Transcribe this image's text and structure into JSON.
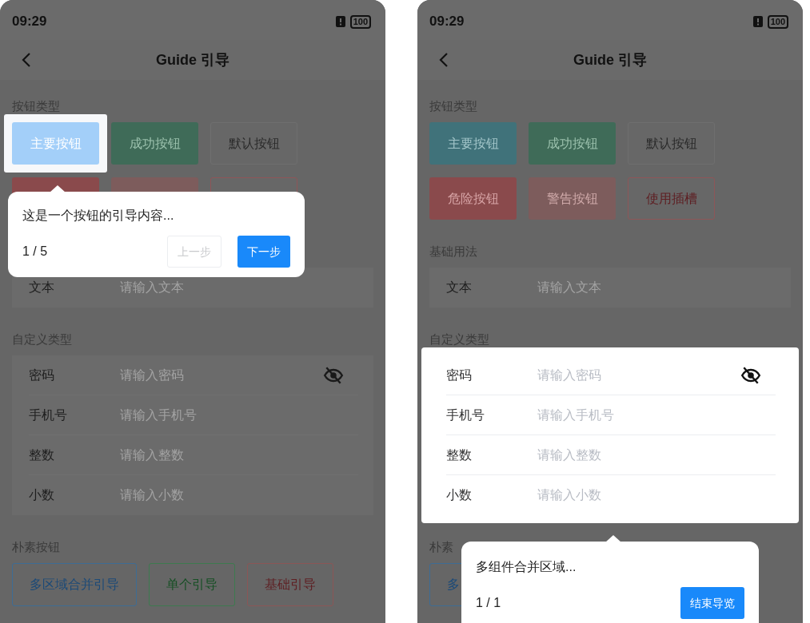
{
  "phones": [
    {
      "status_bar": {
        "time": "09:29",
        "battery": "100"
      },
      "nav": {
        "title": "Guide 引导"
      },
      "sections": [
        {
          "kind": "buttons",
          "title": "按钮类型",
          "rows": [
            [
              {
                "kind": "primary",
                "label": "主要按钮",
                "highlighted": true
              },
              {
                "kind": "success",
                "label": "成功按钮",
                "highlighted": false
              },
              {
                "kind": "default",
                "label": "默认按钮",
                "highlighted": false
              }
            ],
            [
              {
                "kind": "danger",
                "highlighted": false
              },
              {
                "kind": "warning",
                "highlighted": false
              },
              {
                "kind": "plain-danger",
                "highlighted": false
              }
            ]
          ]
        },
        {
          "kind": "fields",
          "highlighted": false,
          "fields": [
            {
              "kind": "text",
              "label": "文本",
              "placeholder": "请输入文本"
            }
          ]
        },
        {
          "kind": "fields",
          "title": "自定义类型",
          "highlighted": false,
          "fields": [
            {
              "kind": "password",
              "label": "密码",
              "placeholder": "请输入密码"
            },
            {
              "kind": "text",
              "label": "手机号",
              "placeholder": "请输入手机号"
            },
            {
              "kind": "text",
              "label": "整数",
              "placeholder": "请输入整数"
            },
            {
              "kind": "text",
              "label": "小数",
              "placeholder": "请输入小数"
            }
          ]
        },
        {
          "kind": "plain_buttons",
          "title": "朴素按钮",
          "buttons": [
            {
              "kind": "primary",
              "label": "多区域合并引导"
            },
            {
              "kind": "success",
              "label": "单个引导"
            },
            {
              "kind": "danger",
              "label": "基础引导"
            }
          ]
        }
      ],
      "popover": {
        "kind": "upper",
        "text": "这是一个按钮的引导内容...",
        "step": "1 / 5",
        "buttons": [
          {
            "kind": "secondary",
            "label": "上一步"
          },
          {
            "kind": "primary",
            "label": "下一步"
          }
        ]
      }
    },
    {
      "status_bar": {
        "time": "09:29",
        "battery": "100"
      },
      "nav": {
        "title": "Guide 引导"
      },
      "sections": [
        {
          "kind": "buttons",
          "title": "按钮类型",
          "rows": [
            [
              {
                "kind": "primary",
                "label": "主要按钮",
                "highlighted": false
              },
              {
                "kind": "success",
                "label": "成功按钮",
                "highlighted": false
              },
              {
                "kind": "default",
                "label": "默认按钮",
                "highlighted": false
              }
            ],
            [
              {
                "kind": "danger",
                "label": "危险按钮",
                "highlighted": false
              },
              {
                "kind": "warning",
                "label": "警告按钮",
                "highlighted": false
              },
              {
                "kind": "plain-danger",
                "label": "使用插槽",
                "highlighted": false
              }
            ]
          ]
        },
        {
          "kind": "fields",
          "title": "基础用法",
          "highlighted": false,
          "fields": [
            {
              "kind": "text",
              "label": "文本",
              "placeholder": "请输入文本"
            }
          ]
        },
        {
          "kind": "fields",
          "title": "自定义类型",
          "highlighted": true,
          "fields": [
            {
              "kind": "password",
              "label": "密码",
              "placeholder": "请输入密码"
            },
            {
              "kind": "text",
              "label": "手机号",
              "placeholder": "请输入手机号"
            },
            {
              "kind": "text",
              "label": "整数",
              "placeholder": "请输入整数"
            },
            {
              "kind": "text",
              "label": "小数",
              "placeholder": "请输入小数"
            }
          ]
        },
        {
          "kind": "plain_buttons",
          "title": "朴素",
          "buttons": [
            {
              "kind": "primary",
              "label": "多"
            }
          ]
        }
      ],
      "popover": {
        "kind": "lower",
        "text": "多组件合并区域...",
        "step": "1 / 1",
        "buttons": [
          {
            "kind": "primary",
            "label": "结束导览"
          }
        ]
      }
    }
  ]
}
